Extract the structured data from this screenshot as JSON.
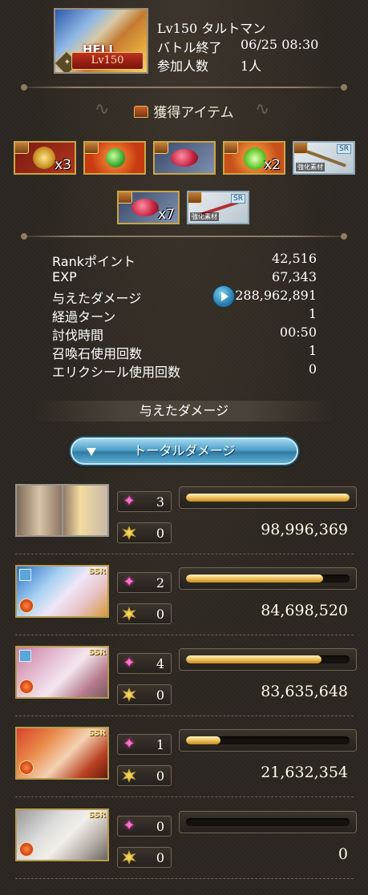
{
  "quest": {
    "badge_text": "HELL",
    "level_badge": "Lv150",
    "title": "Lv150 タルトマン",
    "battle_end_label": "バトル終了",
    "battle_end_value": "06/25 08:30",
    "participants_label": "参加人数",
    "participants_value": "1人"
  },
  "items_section": {
    "title": "獲得アイテム",
    "items": [
      {
        "name": "gold-gear-item",
        "qty": "x3",
        "tag": "",
        "material": ""
      },
      {
        "name": "green-orb-item",
        "qty": "",
        "tag": "",
        "material": ""
      },
      {
        "name": "meat-item",
        "qty": "",
        "tag": "",
        "material": ""
      },
      {
        "name": "green-crystal-item",
        "qty": "x2",
        "tag": "",
        "material": ""
      },
      {
        "name": "enhancement-weapon-item",
        "qty": "",
        "tag": "SR",
        "material": "強化素材"
      },
      {
        "name": "meat-item-2",
        "qty": "x7",
        "tag": "",
        "material": ""
      },
      {
        "name": "enhancement-weapon-item-2",
        "qty": "",
        "tag": "SR",
        "material": "強化素材"
      }
    ]
  },
  "stats": [
    {
      "label": "Rankポイント",
      "value": "42,516"
    },
    {
      "label": "EXP",
      "value": "67,343"
    },
    {
      "label": "与えたダメージ",
      "value": "288,962,891"
    },
    {
      "label": "経過ターン",
      "value": "1"
    },
    {
      "label": "討伐時間",
      "value": "00:50"
    },
    {
      "label": "召喚石使用回数",
      "value": "1"
    },
    {
      "label": "エリクシール使用回数",
      "value": "0"
    }
  ],
  "damage_section": {
    "title": "与えたダメージ",
    "tab_label": "トータルダメージ"
  },
  "characters": [
    {
      "ssr": "",
      "skills": "3",
      "ougi": "0",
      "damage": "98,996,369",
      "bar": 1.0,
      "ring": false,
      "element": false
    },
    {
      "ssr": "SSR",
      "skills": "2",
      "ougi": "0",
      "damage": "84,698,520",
      "bar": 0.84,
      "ring": true,
      "element": true
    },
    {
      "ssr": "SSR",
      "skills": "4",
      "ougi": "0",
      "damage": "83,635,648",
      "bar": 0.83,
      "ring": true,
      "element": true
    },
    {
      "ssr": "SSR",
      "skills": "1",
      "ougi": "0",
      "damage": "21,632,354",
      "bar": 0.21,
      "ring": false,
      "element": true
    },
    {
      "ssr": "SSR",
      "skills": "0",
      "ougi": "0",
      "damage": "0",
      "bar": 0.0,
      "ring": false,
      "element": true
    }
  ]
}
